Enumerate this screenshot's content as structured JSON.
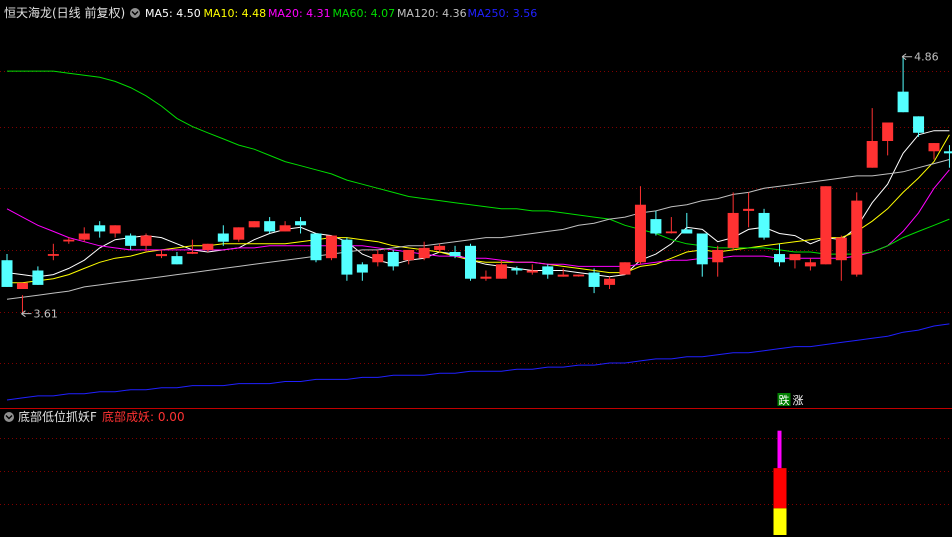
{
  "colors": {
    "background": "#000000",
    "up": "#ff3232",
    "down": "#54ffff",
    "grid": "#800000",
    "ma5": "#ffffff",
    "ma10": "#ffff00",
    "ma20": "#ff00ff",
    "ma60": "#00dd00",
    "ma120": "#c0c0c0",
    "ma250": "#2020ff",
    "indicator_label": "#ff3232",
    "bar_magenta": "#ff00ff",
    "bar_red": "#ff0000",
    "bar_yellow": "#ffff00",
    "tag_die_bg": "#008000",
    "tag_zhang_bg": "#000000"
  },
  "header": {
    "title": "恒天海龙(日线 前复权)",
    "ma_labels": [
      {
        "text": "MA5: 4.50",
        "color": "#ffffff"
      },
      {
        "text": "MA10: 4.48",
        "color": "#ffff00"
      },
      {
        "text": "MA20: 4.31",
        "color": "#ff00ff"
      },
      {
        "text": "MA60: 4.07",
        "color": "#00dd00"
      },
      {
        "text": "MA120: 4.36",
        "color": "#c0c0c0"
      },
      {
        "text": "MA250: 3.56",
        "color": "#2020ff"
      }
    ]
  },
  "indicator": {
    "title": "底部低位抓妖F",
    "value_label": "底部成妖: 0.00"
  },
  "tags": {
    "die": "跌",
    "zhang": "涨"
  },
  "icons": {
    "header_toggle": "chevron-down-icon",
    "indicator_toggle": "chevron-down-icon"
  },
  "chart_data": {
    "type": "candlestick",
    "y_unit": "price",
    "ylim": [
      3.19,
      4.99
    ],
    "price_grid": [
      3.37,
      3.62,
      3.92,
      4.22,
      4.52,
      4.79
    ],
    "annotations": [
      {
        "text": "4.86",
        "candle": 58,
        "value": 4.86
      },
      {
        "text": "3.61",
        "candle": 1,
        "value": 3.61
      }
    ],
    "candles": [
      [
        3.87,
        3.74,
        3.9,
        3.74
      ],
      [
        3.73,
        3.76,
        3.61,
        3.7
      ],
      [
        3.82,
        3.75,
        3.84,
        3.75
      ],
      [
        3.9,
        3.9,
        3.95,
        3.87
      ],
      [
        3.97,
        3.97,
        3.98,
        3.95
      ],
      [
        3.97,
        4.0,
        4.03,
        3.96
      ],
      [
        4.04,
        4.01,
        4.06,
        3.98
      ],
      [
        4.0,
        4.04,
        4.04,
        3.98
      ],
      [
        3.99,
        3.94,
        4.0,
        3.92
      ],
      [
        3.94,
        3.99,
        4.0,
        3.91
      ],
      [
        3.89,
        3.9,
        3.92,
        3.88
      ],
      [
        3.89,
        3.85,
        3.91,
        3.85
      ],
      [
        3.91,
        3.91,
        3.97,
        3.9
      ],
      [
        3.92,
        3.95,
        3.95,
        3.91
      ],
      [
        4.0,
        3.96,
        4.04,
        3.94
      ],
      [
        3.97,
        4.03,
        4.03,
        3.96
      ],
      [
        4.03,
        4.06,
        4.06,
        4.03
      ],
      [
        4.06,
        4.01,
        4.08,
        4.0
      ],
      [
        4.01,
        4.04,
        4.06,
        4.01
      ],
      [
        4.06,
        4.04,
        4.08,
        4.0
      ],
      [
        4.0,
        3.87,
        4.0,
        3.86
      ],
      [
        3.88,
        3.99,
        3.99,
        3.87
      ],
      [
        3.97,
        3.8,
        3.98,
        3.77
      ],
      [
        3.85,
        3.81,
        3.86,
        3.77
      ],
      [
        3.86,
        3.9,
        3.92,
        3.84
      ],
      [
        3.91,
        3.84,
        3.92,
        3.82
      ],
      [
        3.87,
        3.92,
        3.92,
        3.85
      ],
      [
        3.88,
        3.93,
        3.96,
        3.87
      ],
      [
        3.92,
        3.94,
        3.95,
        3.91
      ],
      [
        3.91,
        3.89,
        3.94,
        3.88
      ],
      [
        3.94,
        3.78,
        3.95,
        3.77
      ],
      [
        3.78,
        3.79,
        3.82,
        3.77
      ],
      [
        3.78,
        3.85,
        3.87,
        3.78
      ],
      [
        3.83,
        3.82,
        3.84,
        3.8
      ],
      [
        3.81,
        3.82,
        3.85,
        3.8
      ],
      [
        3.84,
        3.8,
        3.85,
        3.78
      ],
      [
        3.79,
        3.8,
        3.83,
        3.79
      ],
      [
        3.8,
        3.8,
        3.8,
        3.79
      ],
      [
        3.81,
        3.74,
        3.83,
        3.71
      ],
      [
        3.75,
        3.78,
        3.79,
        3.73
      ],
      [
        3.8,
        3.86,
        3.86,
        3.8
      ],
      [
        3.86,
        4.14,
        4.23,
        3.85
      ],
      [
        4.07,
        4.0,
        4.11,
        3.99
      ],
      [
        4.01,
        4.01,
        4.08,
        4.0
      ],
      [
        4.02,
        4.0,
        4.1,
        4.0
      ],
      [
        4.0,
        3.85,
        4.0,
        3.79
      ],
      [
        3.86,
        3.92,
        3.94,
        3.79
      ],
      [
        3.93,
        4.1,
        4.2,
        3.92
      ],
      [
        4.11,
        4.12,
        4.2,
        4.03
      ],
      [
        4.1,
        3.98,
        4.12,
        3.97
      ],
      [
        3.9,
        3.86,
        3.95,
        3.84
      ],
      [
        3.87,
        3.9,
        3.9,
        3.83
      ],
      [
        3.84,
        3.86,
        3.88,
        3.82
      ],
      [
        3.85,
        4.23,
        4.23,
        3.85
      ],
      [
        3.87,
        3.98,
        3.99,
        3.77
      ],
      [
        3.8,
        4.16,
        4.2,
        3.79
      ],
      [
        4.32,
        4.45,
        4.61,
        4.32
      ],
      [
        4.45,
        4.54,
        4.53,
        4.38
      ],
      [
        4.69,
        4.59,
        4.86,
        4.59
      ],
      [
        4.57,
        4.49,
        4.57,
        4.47
      ],
      [
        4.4,
        4.44,
        4.44,
        4.36
      ],
      [
        4.4,
        4.39,
        4.43,
        4.32
      ]
    ],
    "series": [
      {
        "name": "MA5",
        "values": [
          3.81,
          3.8,
          3.79,
          3.8,
          3.83,
          3.87,
          3.93,
          3.97,
          3.98,
          3.99,
          3.98,
          3.95,
          3.92,
          3.91,
          3.92,
          3.93,
          3.97,
          4.0,
          4.02,
          4.03,
          4.0,
          3.99,
          3.96,
          3.9,
          3.87,
          3.85,
          3.87,
          3.88,
          3.91,
          3.9,
          3.87,
          3.85,
          3.84,
          3.83,
          3.82,
          3.82,
          3.82,
          3.81,
          3.8,
          3.79,
          3.8,
          3.87,
          3.9,
          3.95,
          4.03,
          4.02,
          3.96,
          3.98,
          4.02,
          4.03,
          4.0,
          3.99,
          3.95,
          3.98,
          3.97,
          4.03,
          4.15,
          4.24,
          4.39,
          4.48,
          4.5,
          4.5
        ]
      },
      {
        "name": "MA10",
        "values": [
          3.76,
          3.76,
          3.77,
          3.78,
          3.8,
          3.83,
          3.86,
          3.88,
          3.89,
          3.91,
          3.92,
          3.93,
          3.94,
          3.94,
          3.95,
          3.95,
          3.95,
          3.95,
          3.95,
          3.96,
          3.97,
          3.98,
          3.98,
          3.97,
          3.96,
          3.94,
          3.93,
          3.92,
          3.91,
          3.89,
          3.87,
          3.86,
          3.86,
          3.86,
          3.86,
          3.85,
          3.84,
          3.83,
          3.82,
          3.81,
          3.81,
          3.84,
          3.85,
          3.88,
          3.91,
          3.92,
          3.91,
          3.92,
          3.93,
          3.94,
          3.95,
          3.96,
          3.97,
          3.98,
          3.98,
          4.01,
          4.06,
          4.12,
          4.2,
          4.27,
          4.35,
          4.48
        ]
      },
      {
        "name": "MA20",
        "values": [
          4.12,
          4.08,
          4.04,
          4.01,
          3.98,
          3.96,
          3.94,
          3.93,
          3.92,
          3.92,
          3.92,
          3.92,
          3.92,
          3.92,
          3.92,
          3.93,
          3.93,
          3.94,
          3.94,
          3.94,
          3.94,
          3.94,
          3.94,
          3.94,
          3.93,
          3.92,
          3.91,
          3.9,
          3.89,
          3.89,
          3.88,
          3.88,
          3.87,
          3.86,
          3.86,
          3.85,
          3.85,
          3.84,
          3.84,
          3.84,
          3.84,
          3.85,
          3.86,
          3.87,
          3.87,
          3.88,
          3.88,
          3.89,
          3.89,
          3.89,
          3.88,
          3.88,
          3.88,
          3.88,
          3.88,
          3.89,
          3.91,
          3.94,
          4.01,
          4.1,
          4.22,
          4.31
        ]
      },
      {
        "name": "MA60",
        "values": [
          4.79,
          4.79,
          4.79,
          4.79,
          4.78,
          4.77,
          4.76,
          4.74,
          4.71,
          4.67,
          4.62,
          4.56,
          4.52,
          4.49,
          4.46,
          4.43,
          4.41,
          4.38,
          4.35,
          4.33,
          4.31,
          4.29,
          4.26,
          4.24,
          4.22,
          4.2,
          4.18,
          4.17,
          4.16,
          4.15,
          4.14,
          4.13,
          4.12,
          4.12,
          4.11,
          4.11,
          4.1,
          4.09,
          4.08,
          4.07,
          4.04,
          4.02,
          4.0,
          3.97,
          3.95,
          3.94,
          3.93,
          3.93,
          3.93,
          3.93,
          3.92,
          3.91,
          3.91,
          3.9,
          3.9,
          3.9,
          3.91,
          3.94,
          3.98,
          4.01,
          4.04,
          4.07
        ]
      },
      {
        "name": "MA120",
        "values": [
          3.68,
          3.69,
          3.7,
          3.71,
          3.72,
          3.74,
          3.75,
          3.76,
          3.77,
          3.78,
          3.79,
          3.8,
          3.81,
          3.82,
          3.83,
          3.84,
          3.85,
          3.86,
          3.87,
          3.88,
          3.89,
          3.9,
          3.91,
          3.92,
          3.92,
          3.93,
          3.94,
          3.94,
          3.95,
          3.96,
          3.97,
          3.98,
          3.98,
          3.99,
          4.0,
          4.01,
          4.02,
          4.04,
          4.05,
          4.07,
          4.08,
          4.1,
          4.11,
          4.13,
          4.14,
          4.16,
          4.17,
          4.19,
          4.2,
          4.22,
          4.23,
          4.24,
          4.25,
          4.26,
          4.27,
          4.28,
          4.28,
          4.29,
          4.3,
          4.32,
          4.34,
          4.36
        ]
      },
      {
        "name": "MA250",
        "values": [
          3.19,
          3.2,
          3.21,
          3.21,
          3.22,
          3.22,
          3.23,
          3.23,
          3.24,
          3.24,
          3.25,
          3.25,
          3.26,
          3.26,
          3.26,
          3.27,
          3.27,
          3.27,
          3.28,
          3.28,
          3.29,
          3.29,
          3.29,
          3.3,
          3.3,
          3.31,
          3.31,
          3.31,
          3.32,
          3.32,
          3.33,
          3.33,
          3.33,
          3.34,
          3.34,
          3.35,
          3.35,
          3.36,
          3.36,
          3.37,
          3.37,
          3.38,
          3.39,
          3.39,
          3.4,
          3.4,
          3.41,
          3.42,
          3.42,
          3.43,
          3.44,
          3.45,
          3.45,
          3.46,
          3.47,
          3.48,
          3.49,
          3.5,
          3.52,
          3.53,
          3.55,
          3.56
        ]
      }
    ],
    "indicator_bar": {
      "name": "底部成妖",
      "candle": 50,
      "segments": [
        {
          "color": "#ffff00",
          "from": 0,
          "to": 1
        },
        {
          "color": "#ff0000",
          "from": 1,
          "to": 2.5
        },
        {
          "color": "#ff00ff",
          "from": 2.5,
          "to": 3.9
        }
      ],
      "ylim": [
        0,
        4
      ]
    },
    "signal_tags": {
      "candle": 50,
      "labels": [
        "跌",
        "涨"
      ]
    }
  }
}
